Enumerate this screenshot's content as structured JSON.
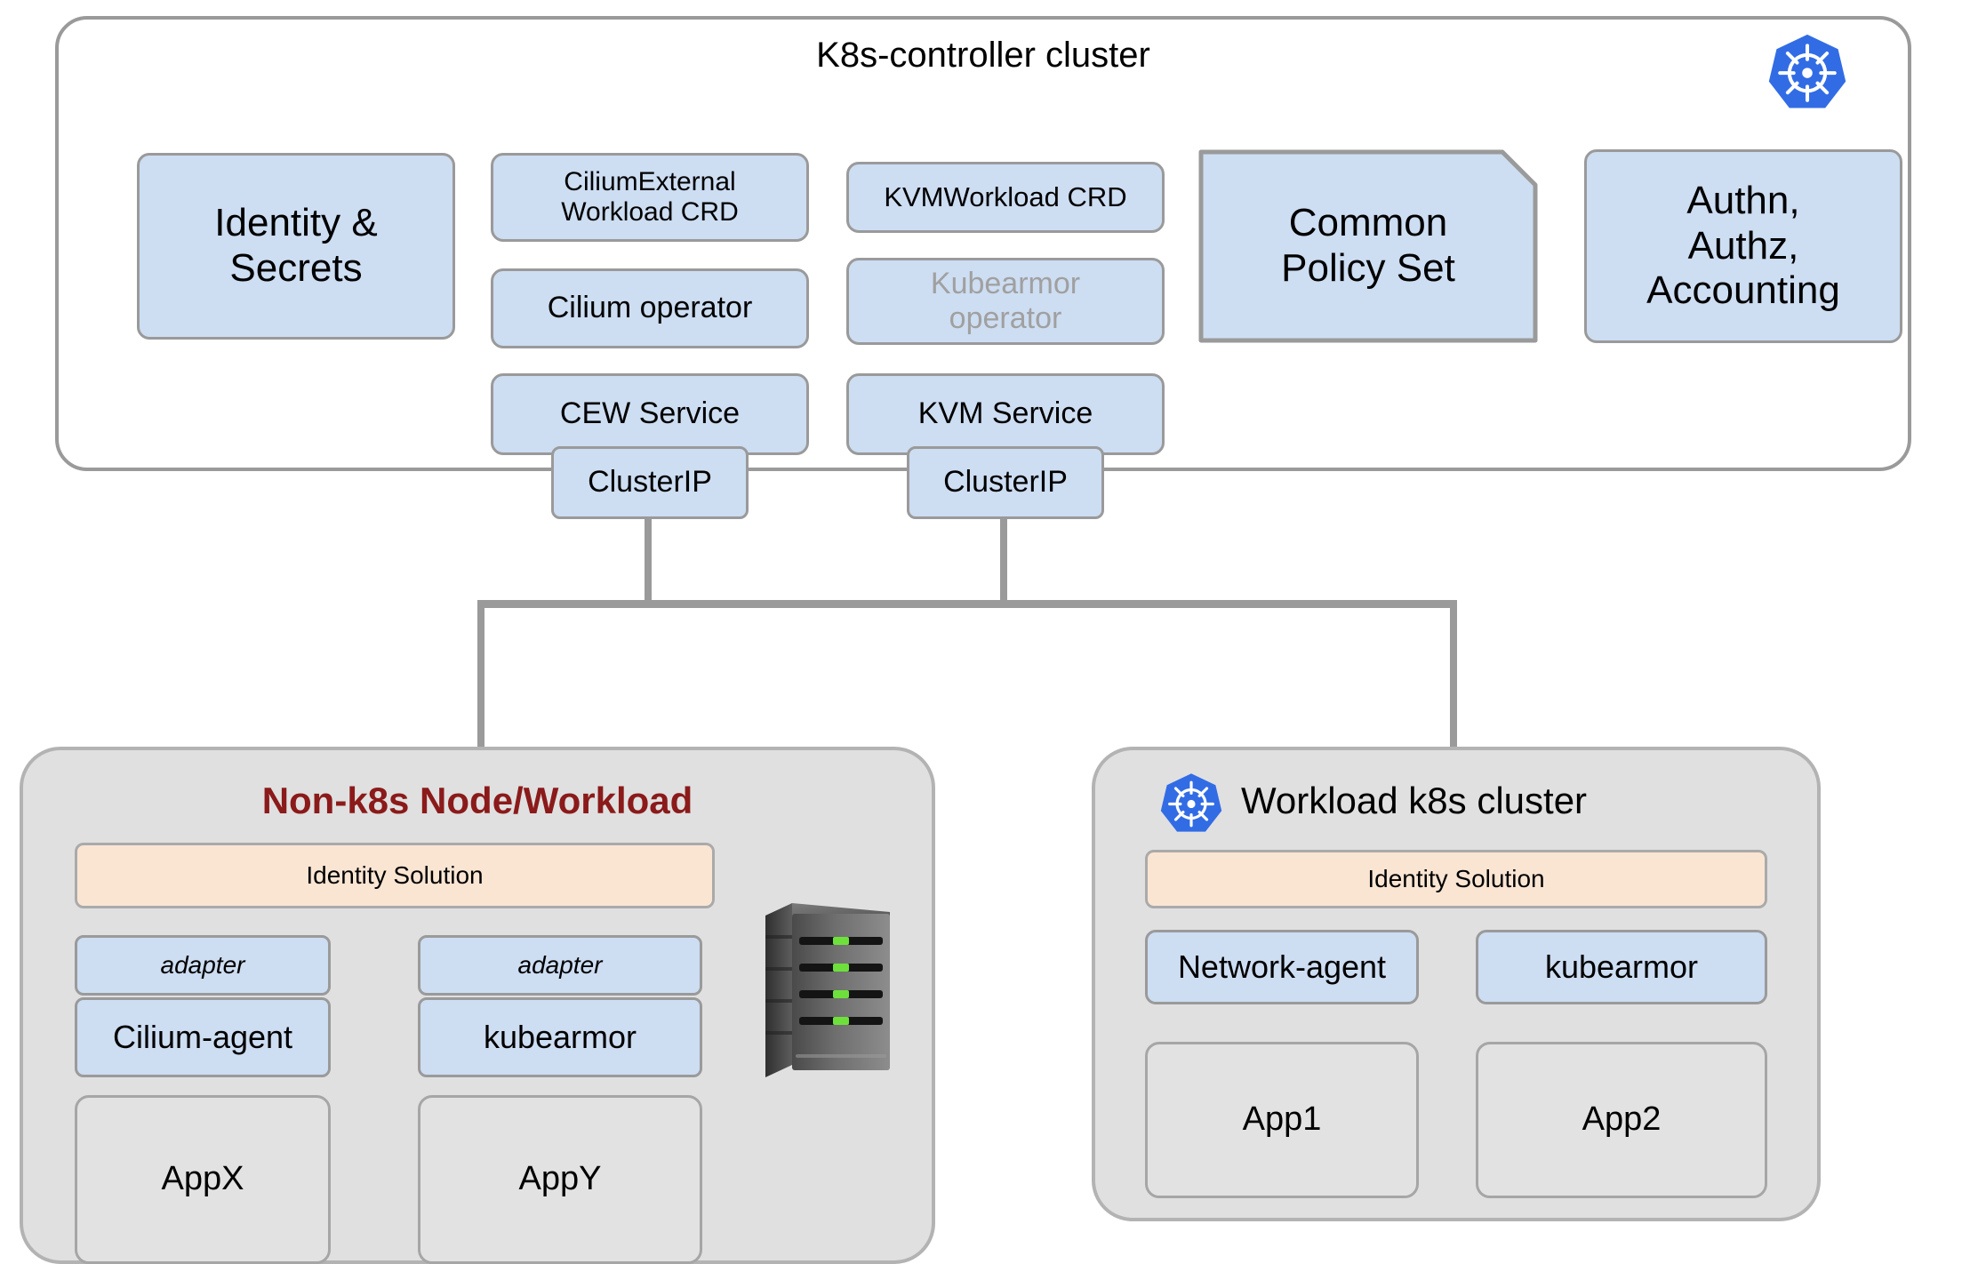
{
  "diagram": {
    "title": "K8s-controller cluster",
    "controller_cluster": {
      "label": "K8s-controller cluster",
      "logo": "kubernetes-logo",
      "nodes": {
        "identity_secrets": "Identity & Secrets",
        "cew_crd": "CiliumExternal Workload CRD",
        "cilium_operator": "Cilium operator",
        "cew_service": "CEW Service",
        "cew_clusterip": "ClusterIP",
        "kvm_crd": "KVMWorkload CRD",
        "kubearmor_operator": "Kubearmor operator",
        "kvm_service": "KVM Service",
        "kvm_clusterip": "ClusterIP",
        "common_policy_set": "Common Policy Set",
        "authn": "Authn, Authz, Accounting"
      }
    },
    "non_k8s_node": {
      "title": "Non-k8s Node/Workload",
      "title_color": "#8b1a1a",
      "identity_solution": "Identity Solution",
      "adapter_left": "adapter",
      "adapter_right": "adapter",
      "cilium_agent": "Cilium-agent",
      "kubearmor": "kubearmor",
      "app_x": "AppX",
      "app_y": "AppY",
      "server_icon": "server-tower-icon"
    },
    "workload_cluster": {
      "title": "Workload k8s cluster",
      "logo": "kubernetes-logo",
      "identity_solution": "Identity Solution",
      "network_agent": "Network-agent",
      "kubearmor": "kubearmor",
      "app1": "App1",
      "app2": "App2"
    },
    "colors": {
      "blue_fill": "#cdddf2",
      "peach_fill": "#fae5d3",
      "grey_fill": "#e0e0e0",
      "border_grey": "#9a9a9a",
      "k8s_blue": "#326ce5",
      "title_red": "#8b1a1a",
      "muted_text": "#a0a0a0",
      "led_green": "#6ee03c"
    }
  }
}
